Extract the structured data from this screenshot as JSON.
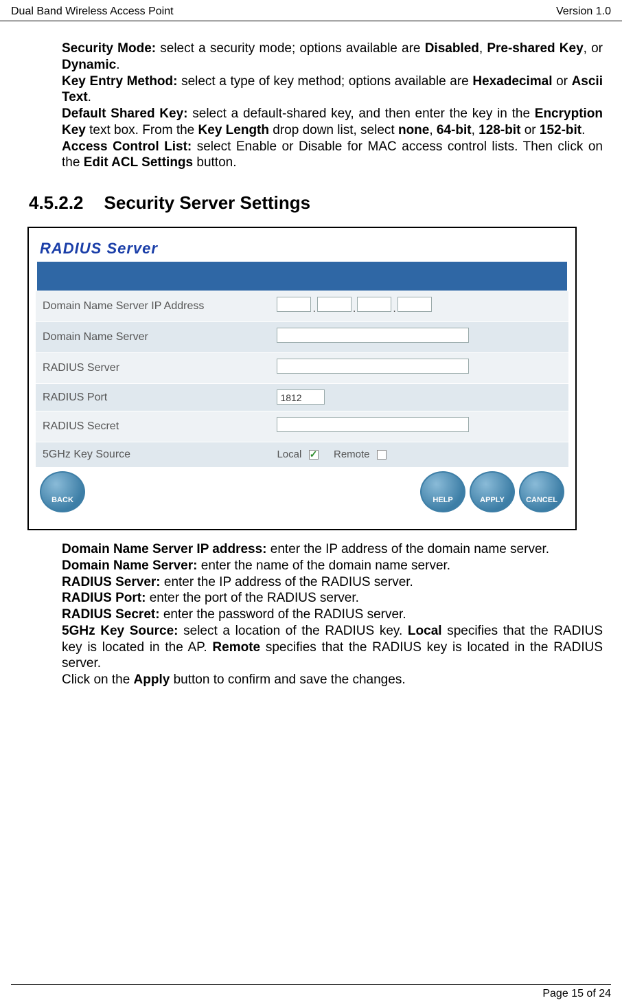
{
  "header": {
    "left": "Dual Band Wireless Access Point",
    "right": "Version 1.0"
  },
  "top_paragraphs": {
    "p1_b1": "Security Mode:",
    "p1_t1": " select a security mode; options available are ",
    "p1_b2": "Disabled",
    "p1_t2": ", ",
    "p1_b3": "Pre-shared Key",
    "p1_t3": ", or ",
    "p1_b4": "Dynamic",
    "p1_t4": ".",
    "p2_b1": "Key Entry Method:",
    "p2_t1": " select a type of key method; options available are ",
    "p2_b2": "Hexadecimal",
    "p2_t2": " or ",
    "p2_b3": "Ascii Text",
    "p2_t3": ".",
    "p3_b1": "Default Shared Key:",
    "p3_t1": " select a default-shared key, and then enter the key in the ",
    "p3_b2": "Encryption Key",
    "p3_t2": " text box. From the ",
    "p3_b3": "Key Length",
    "p3_t3": " drop down list, select ",
    "p3_b4": "none",
    "p3_t4": ", ",
    "p3_b5": "64-bit",
    "p3_t5": ", ",
    "p3_b6": "128-bit",
    "p3_t6": " or ",
    "p3_b7": "152-bit",
    "p3_t7": ".",
    "p4_b1": "Access Control List:",
    "p4_t1": "  select Enable or Disable for MAC access control lists. Then click on the ",
    "p4_b2": "Edit ACL Settings",
    "p4_t2": " button."
  },
  "section": {
    "number": "4.5.2.2",
    "title": "Security Server Settings"
  },
  "radius": {
    "title": "RADIUS Server",
    "rows": {
      "dns_ip": "Domain Name Server IP Address",
      "dns": "Domain Name Server",
      "server": "RADIUS Server",
      "port": "RADIUS Port",
      "port_value": "1812",
      "secret": "RADIUS Secret",
      "keysrc": "5GHz Key Source",
      "local": "Local",
      "remote": "Remote"
    },
    "buttons": {
      "back": "BACK",
      "help": "HELP",
      "apply": "APPLY",
      "cancel": "CANCEL"
    }
  },
  "bottom_paragraphs": {
    "p1_b1": "Domain Name Server IP address:",
    "p1_t1": " enter the IP address of the domain name server.",
    "p2_b1": "Domain Name Server:",
    "p2_t1": " enter the name of the domain name server.",
    "p3_b1": "RADIUS Server:",
    "p3_t1": " enter the IP address of the RADIUS server.",
    "p4_b1": "RADIUS Port:",
    "p4_t1": " enter the port of the RADIUS server.",
    "p5_b1": "RADIUS Secret:",
    "p5_t1": " enter the password of the RADIUS server.",
    "p6_b1": "5GHz Key Source:",
    "p6_t1": " select a location of the RADIUS key.  ",
    "p6_b2": "Local",
    "p6_t2": " specifies that the RADIUS key is located in the AP.  ",
    "p6_b3": "Remote",
    "p6_t3": " specifies that the RADIUS key is located in the RADIUS server.",
    "p7_t1": "Click on the ",
    "p7_b1": "Apply",
    "p7_t2": " button to confirm and save the changes."
  },
  "footer": "Page 15 of 24"
}
